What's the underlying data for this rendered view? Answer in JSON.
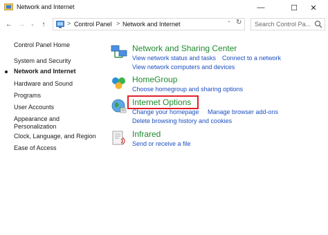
{
  "window": {
    "title": "Network and Internet",
    "buttons": {
      "minimize": "—",
      "maximize": "☐",
      "close": "✕"
    }
  },
  "navbar": {
    "back": "←",
    "forward": "→",
    "recent": "⌄",
    "up": "↑",
    "breadcrumbs": [
      "Control Panel",
      "Network and Internet"
    ],
    "separator": ">",
    "dropdown": "⌄",
    "refresh": "↻",
    "search_placeholder": "Search Control Pa..."
  },
  "sidebar": {
    "items": [
      {
        "label": "Control Panel Home",
        "active": false
      },
      {
        "label": "System and Security",
        "active": false
      },
      {
        "label": "Network and Internet",
        "active": true
      },
      {
        "label": "Hardware and Sound",
        "active": false
      },
      {
        "label": "Programs",
        "active": false
      },
      {
        "label": "User Accounts",
        "active": false
      },
      {
        "label": "Appearance and",
        "active": false
      },
      {
        "label": "Personalization",
        "active": false
      },
      {
        "label": "Clock, Language, and Region",
        "active": false
      },
      {
        "label": "Ease of Access",
        "active": false
      }
    ]
  },
  "categories": [
    {
      "title": "Network and Sharing Center",
      "icon": "network-sharing-icon",
      "links": [
        "View network status and tasks",
        "Connect to a network",
        "View network computers and devices"
      ]
    },
    {
      "title": "HomeGroup",
      "icon": "homegroup-icon",
      "links": [
        "Choose homegroup and sharing options"
      ]
    },
    {
      "title": "Internet Options",
      "icon": "internet-options-icon",
      "links": [
        "Change your homepage",
        "Manage browser add-ons",
        "Delete browsing history and cookies"
      ]
    },
    {
      "title": "Infrared",
      "icon": "infrared-icon",
      "links": [
        "Send or receive a file"
      ]
    }
  ],
  "colors": {
    "title_green": "#1f8a2e",
    "link_blue": "#1d4fbf",
    "highlight_red": "#e0202a"
  }
}
